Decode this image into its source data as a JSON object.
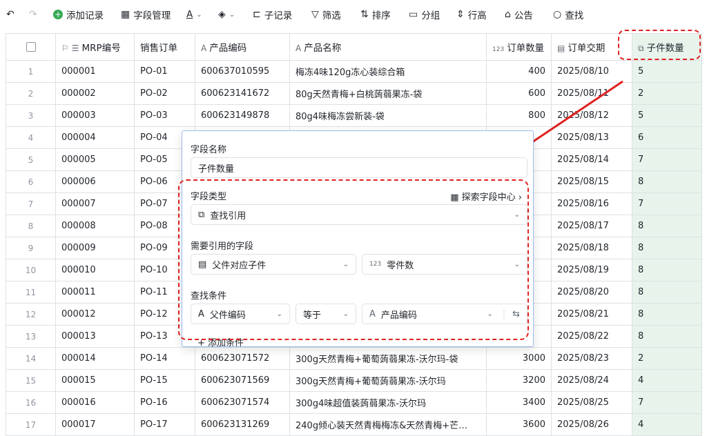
{
  "toolbar": {
    "add_record": "添加记录",
    "field_manage": "字段管理",
    "text_color": "A",
    "fill_color": "◈",
    "sub_record": "子记录",
    "filter": "筛选",
    "sort": "排序",
    "group": "分组",
    "row_height": "行高",
    "announcement": "公告",
    "search": "查找"
  },
  "table": {
    "headers": [
      "MRP编号",
      "销售订单",
      "产品编码",
      "产品名称",
      "订单数量",
      "订单交期",
      "子件数量"
    ],
    "header_icons": [
      "flag-icon",
      "list-icon",
      "text-type-icon",
      "text-type-icon",
      "number-type-icon",
      "date-icon",
      "lookup-icon"
    ],
    "number_prefix": "123",
    "rows": [
      {
        "n": "1",
        "mrp": "000001",
        "so": "PO-01",
        "code": "600637010595",
        "name": "梅冻4味120g冻心装综合箱",
        "qty": "400",
        "date": "2025/08/10",
        "sub": "5"
      },
      {
        "n": "2",
        "mrp": "000002",
        "so": "PO-02",
        "code": "600623141672",
        "name": "80g天然青梅+白桃蒟蒻果冻-袋",
        "qty": "600",
        "date": "2025/08/11",
        "sub": "2"
      },
      {
        "n": "3",
        "mrp": "000003",
        "so": "PO-03",
        "code": "600623149878",
        "name": "80g4味梅冻尝新装-袋",
        "qty": "800",
        "date": "2025/08/12",
        "sub": "5"
      },
      {
        "n": "4",
        "mrp": "000004",
        "so": "PO-04",
        "code": "",
        "name": "",
        "qty": "",
        "date": "2025/08/13",
        "sub": "6"
      },
      {
        "n": "5",
        "mrp": "000005",
        "so": "PO-05",
        "code": "",
        "name": "",
        "qty": "",
        "date": "2025/08/14",
        "sub": "7"
      },
      {
        "n": "6",
        "mrp": "000006",
        "so": "PO-06",
        "code": "",
        "name": "",
        "qty": "",
        "date": "2025/08/15",
        "sub": "8"
      },
      {
        "n": "7",
        "mrp": "000007",
        "so": "PO-07",
        "code": "",
        "name": "",
        "qty": "",
        "date": "2025/08/16",
        "sub": "7"
      },
      {
        "n": "8",
        "mrp": "000008",
        "so": "PO-08",
        "code": "",
        "name": "",
        "qty": "",
        "date": "2025/08/17",
        "sub": "8"
      },
      {
        "n": "9",
        "mrp": "000009",
        "so": "PO-09",
        "code": "",
        "name": "",
        "qty": "",
        "date": "2025/08/18",
        "sub": "8"
      },
      {
        "n": "10",
        "mrp": "000010",
        "so": "PO-10",
        "code": "",
        "name": "",
        "qty": "",
        "date": "2025/08/19",
        "sub": "8"
      },
      {
        "n": "11",
        "mrp": "000011",
        "so": "PO-11",
        "code": "",
        "name": "",
        "qty": "",
        "date": "2025/08/20",
        "sub": "8"
      },
      {
        "n": "12",
        "mrp": "000012",
        "so": "PO-12",
        "code": "",
        "name": "",
        "qty": "",
        "date": "2025/08/21",
        "sub": "8"
      },
      {
        "n": "13",
        "mrp": "000013",
        "so": "PO-13",
        "code": "",
        "name": "",
        "qty": "",
        "date": "2025/08/22",
        "sub": "8"
      },
      {
        "n": "14",
        "mrp": "000014",
        "so": "PO-14",
        "code": "600623071572",
        "name": "300g天然青梅+葡萄蒟蒻果冻-沃尔玛-袋",
        "qty": "3000",
        "date": "2025/08/23",
        "sub": "2"
      },
      {
        "n": "15",
        "mrp": "000015",
        "so": "PO-15",
        "code": "600623071569",
        "name": "300g天然青梅+葡萄蒟蒻果冻-沃尔玛",
        "qty": "3200",
        "date": "2025/08/24",
        "sub": "4"
      },
      {
        "n": "16",
        "mrp": "000016",
        "so": "PO-16",
        "code": "600623071574",
        "name": "300g4味超值装蒟蒻果冻-沃尔玛",
        "qty": "3400",
        "date": "2025/08/25",
        "sub": "7"
      },
      {
        "n": "17",
        "mrp": "000017",
        "so": "PO-17",
        "code": "600623131269",
        "name": "240g倾心装天然青梅梅冻&天然青梅+芒…",
        "qty": "3600",
        "date": "2025/08/26",
        "sub": "4"
      }
    ]
  },
  "panel": {
    "field_name_label": "字段名称",
    "field_name_value": "子件数量",
    "field_type_label": "字段类型",
    "explore_link": "探索字段中心",
    "field_type_value": "查找引用",
    "ref_field_label": "需要引用的字段",
    "ref_table": "父件对应子件",
    "ref_field": "零件数",
    "ref_field_prefix": "123",
    "condition_label": "查找条件",
    "cond_left": "父件编码",
    "cond_op": "等于",
    "cond_right": "产品编码",
    "add_condition": "添加条件"
  },
  "colors": {
    "annotation_red": "#e02020",
    "lookup_column_bg": "#e8f3ec",
    "panel_border": "#9bbcf0"
  }
}
